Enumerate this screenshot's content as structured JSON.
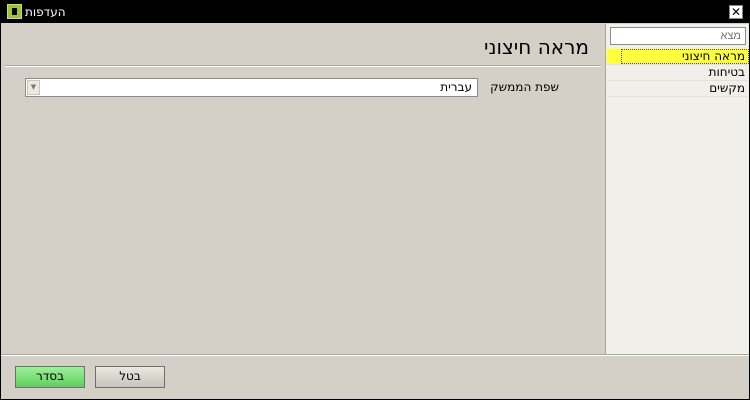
{
  "window": {
    "title": "העדפות",
    "close_glyph": "✕"
  },
  "sidebar": {
    "search_placeholder": "מצא",
    "items": [
      {
        "label": "מראה חיצוני",
        "selected": true
      },
      {
        "label": "בטיחות",
        "selected": false
      },
      {
        "label": "מקשים",
        "selected": false
      }
    ]
  },
  "main": {
    "title": "מראה חיצוני",
    "interface_language": {
      "label": "שפת הממשק",
      "value": "עברית"
    }
  },
  "footer": {
    "ok_label": "בסדר",
    "cancel_label": "בטל"
  },
  "colors": {
    "selected_item": "#ffff3c",
    "ok_button": "#6fdc6b",
    "app_icon": "#9ec33a"
  },
  "icons": {
    "app": "app-icon",
    "close": "close-icon",
    "dropdown": "chevron-down-icon"
  }
}
